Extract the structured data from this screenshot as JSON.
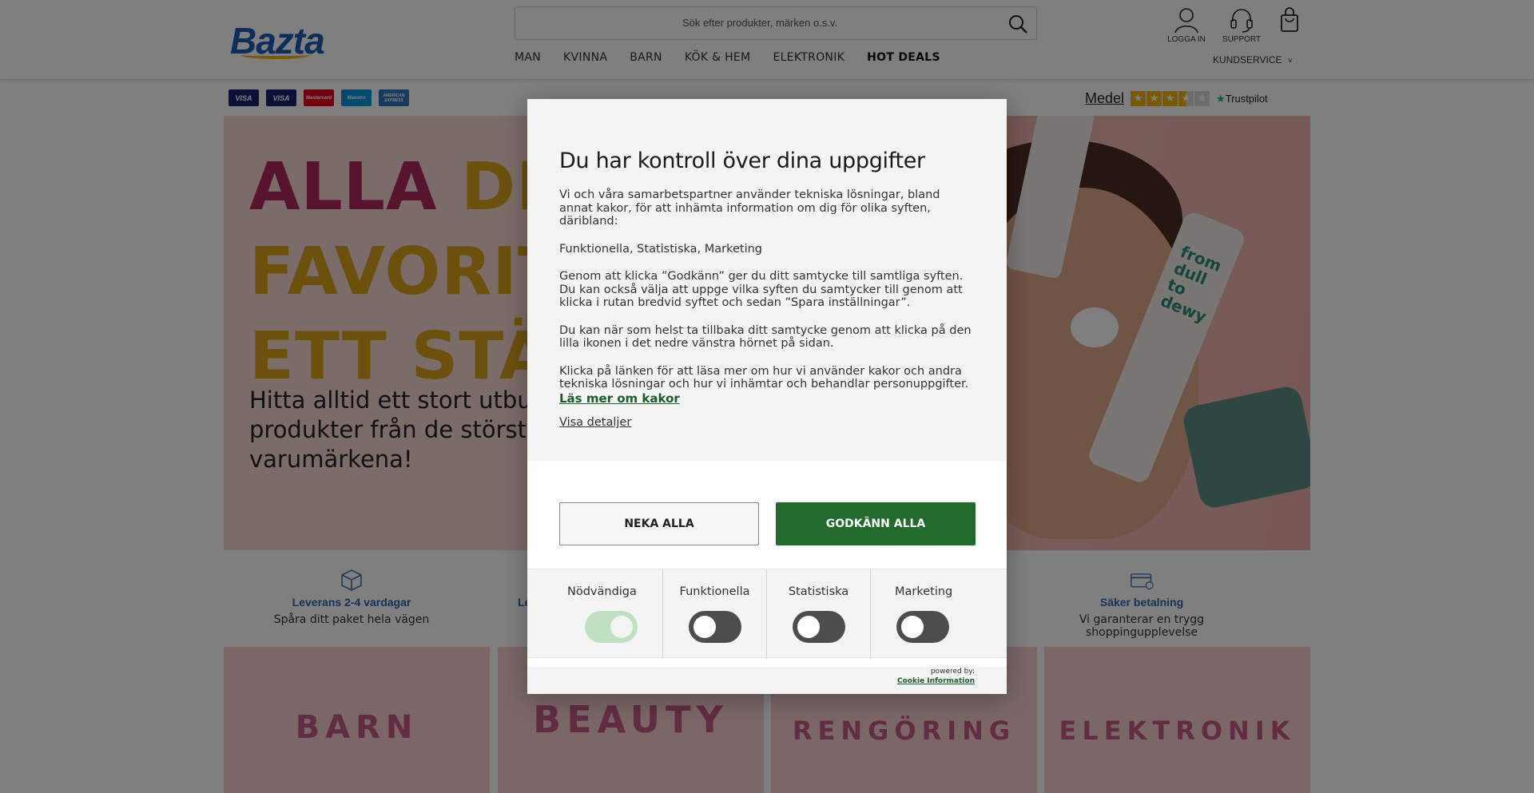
{
  "header": {
    "logo_text": "Bazta",
    "search_placeholder": "Sök efter produkter, märken o.s.v.",
    "nav": [
      "MAN",
      "KVINNA",
      "BARN",
      "KÖK & HEM",
      "ELEKTRONIK",
      "HOT DEALS"
    ],
    "login_label": "LOGGA IN",
    "support_label": "SUPPORT",
    "kundservice_label": "KUNDSERVICE"
  },
  "payments": {
    "cards": [
      {
        "label": "VISA",
        "color": "#1a1f71"
      },
      {
        "label": "VISA",
        "color": "#1a1f71"
      },
      {
        "label": "Mastercard",
        "color": "#eb001b"
      },
      {
        "label": "Maestro",
        "color": "#0099df"
      },
      {
        "label": "AMERICAN EXPRESS",
        "color": "#2e77bc"
      }
    ]
  },
  "trustpilot": {
    "rating_text": "Medel",
    "stars_filled": 3.5,
    "brand": "Trustpilot"
  },
  "hero": {
    "line1_a": "ALLA",
    "line1_b": "DIN",
    "line2": "FAVORIT",
    "line3": "ETT STÄL",
    "subtitle": "Hitta alltid ett stort utbud produkter från de största varumärkena!",
    "tube_text": "from dull to dewy"
  },
  "usp": [
    {
      "title": "Leverans 2-4 vardagar",
      "subtitle": "Spåra ditt paket hela vägen"
    },
    {
      "title": "Le",
      "subtitle": ""
    },
    {
      "title": "Säker betalning",
      "subtitle": "Vi garanterar en trygg shoppingupplevelse"
    }
  ],
  "categories": [
    "BARN",
    "BEAUTY",
    "RENGÖRING",
    "ELEKTRONIK"
  ],
  "cookie_modal": {
    "title": "Du har kontroll över dina uppgifter",
    "paragraphs": [
      "Vi och våra samarbetspartner använder tekniska lösningar, bland annat kakor, för att inhämta information om dig för olika syften, däribland:",
      "Funktionella, Statistiska, Marketing",
      "Genom att klicka ”Godkänn” ger du ditt samtycke till samtliga syften. Du kan också välja att uppge vilka syften du samtycker till genom att klicka i rutan bredvid syftet och sedan ”Spara inställningar”.",
      "Du kan när som helst ta tillbaka ditt samtycke genom att klicka på den lilla ikonen i det nedre vänstra hörnet på sidan.",
      "Klicka på länken för att läsa mer om hur vi använder kakor och andra tekniska lösningar och hur vi inhämtar och behandlar personuppgifter."
    ],
    "link_more": "Läs mer om kakor",
    "link_details": "Visa detaljer",
    "deny_label": "NEKA ALLA",
    "accept_label": "GODKÄNN ALLA",
    "toggles": [
      {
        "label": "Nödvändiga",
        "on": true
      },
      {
        "label": "Funktionella",
        "on": false
      },
      {
        "label": "Statistiska",
        "on": false
      },
      {
        "label": "Marketing",
        "on": false
      }
    ],
    "powered_by": "powered by:",
    "powered_brand": "Cookie Information",
    "accept_color": "#236a2e"
  }
}
